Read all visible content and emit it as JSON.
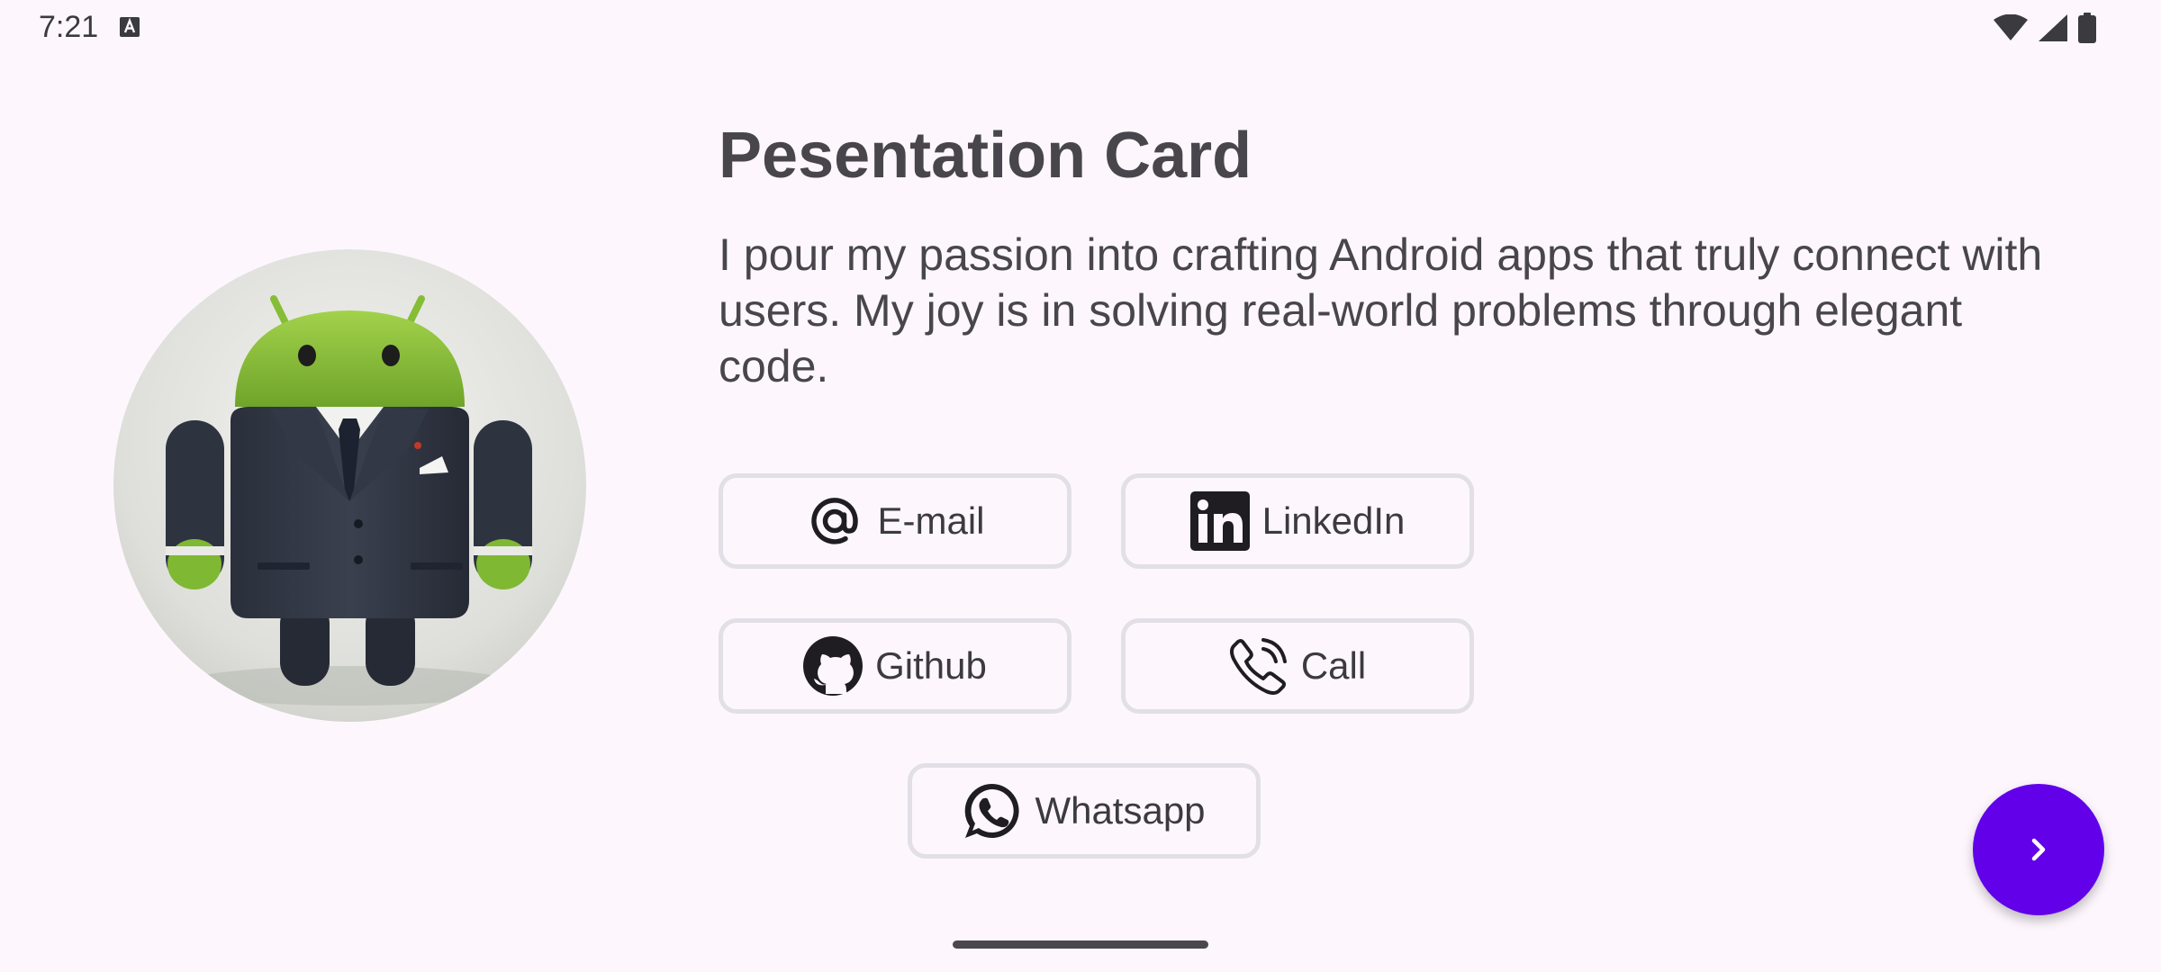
{
  "status_bar": {
    "time": "7:21",
    "icons": [
      "a-notification-icon",
      "wifi-icon",
      "signal-icon",
      "battery-icon"
    ]
  },
  "card": {
    "title": "Pesentation Card",
    "description": "I pour my passion into crafting Android apps that truly connect with users. My joy is in solving real-world problems through elegant code.",
    "avatar_icon": "android-in-suit-avatar"
  },
  "buttons": {
    "email": {
      "label": "E-mail",
      "icon": "at-sign-icon"
    },
    "linkedin": {
      "label": "LinkedIn",
      "icon": "linkedin-icon"
    },
    "github": {
      "label": "Github",
      "icon": "github-icon"
    },
    "call": {
      "label": "Call",
      "icon": "phone-icon"
    },
    "whatsapp": {
      "label": "Whatsapp",
      "icon": "whatsapp-icon"
    }
  },
  "fab": {
    "icon": "chevron-right-icon"
  },
  "colors": {
    "background": "#fdf7fd",
    "text": "#48464c",
    "button_border": "#e2dfe7",
    "fab": "#6200ea"
  }
}
